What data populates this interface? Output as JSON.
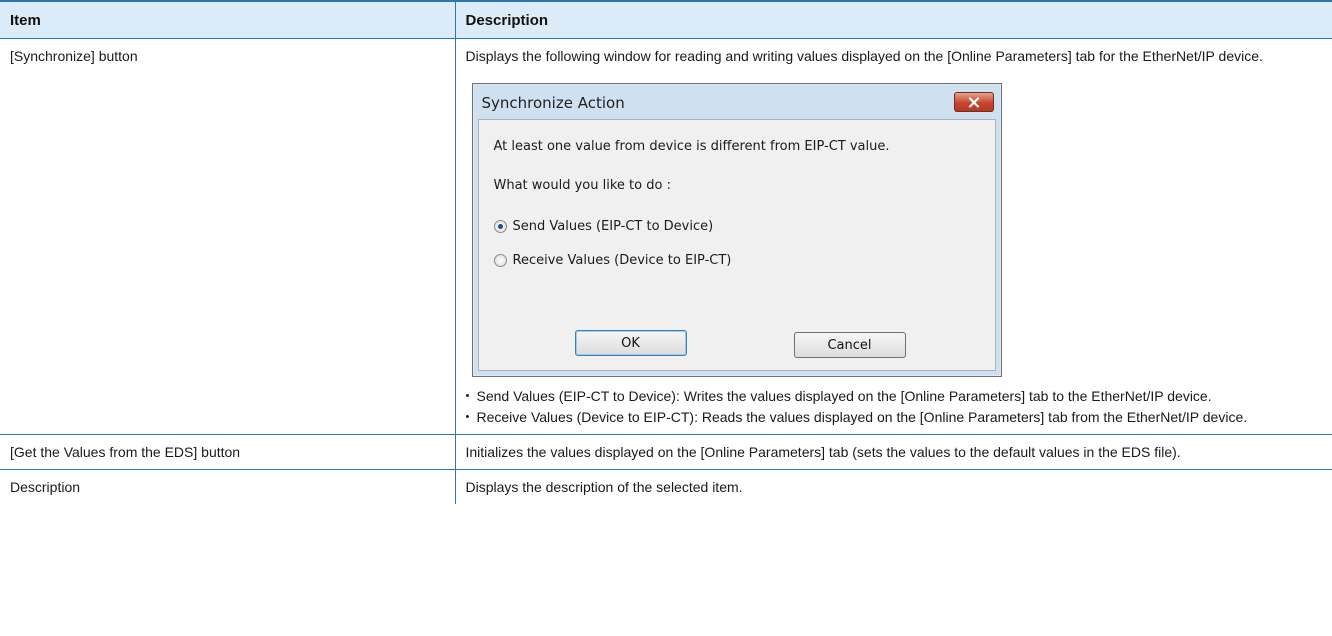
{
  "table": {
    "headers": [
      "Item",
      "Description"
    ],
    "rows": [
      {
        "item": "[Synchronize] button",
        "description": "Displays the following window for reading and writing values displayed on the [Online Parameters] tab for the EtherNet/IP device.",
        "bullets": [
          "Send Values (EIP-CT to Device): Writes the values displayed on the [Online Parameters] tab to the EtherNet/IP device.",
          "Receive Values (Device to EIP-CT): Reads the values displayed on the [Online Parameters] tab from the EtherNet/IP device."
        ]
      },
      {
        "item": "[Get the Values from the EDS] button",
        "description": "Initializes the values displayed on the [Online Parameters] tab (sets the values to the default values in the EDS file)."
      },
      {
        "item": "Description",
        "description": "Displays the description of the selected item."
      }
    ]
  },
  "dialog": {
    "title": "Synchronize Action",
    "message": "At least one value from device is different from EIP-CT value.",
    "prompt": "What would you like to do :",
    "options": [
      {
        "label": "Send Values (EIP-CT to Device)",
        "selected": true
      },
      {
        "label": "Receive Values (Device to EIP-CT)",
        "selected": false
      }
    ],
    "ok_label": "OK",
    "cancel_label": "Cancel",
    "close_icon": "close-icon"
  },
  "colors": {
    "header_background": "#dcebf8",
    "rule": "#2f75b5",
    "close_button": "#c6462e"
  }
}
